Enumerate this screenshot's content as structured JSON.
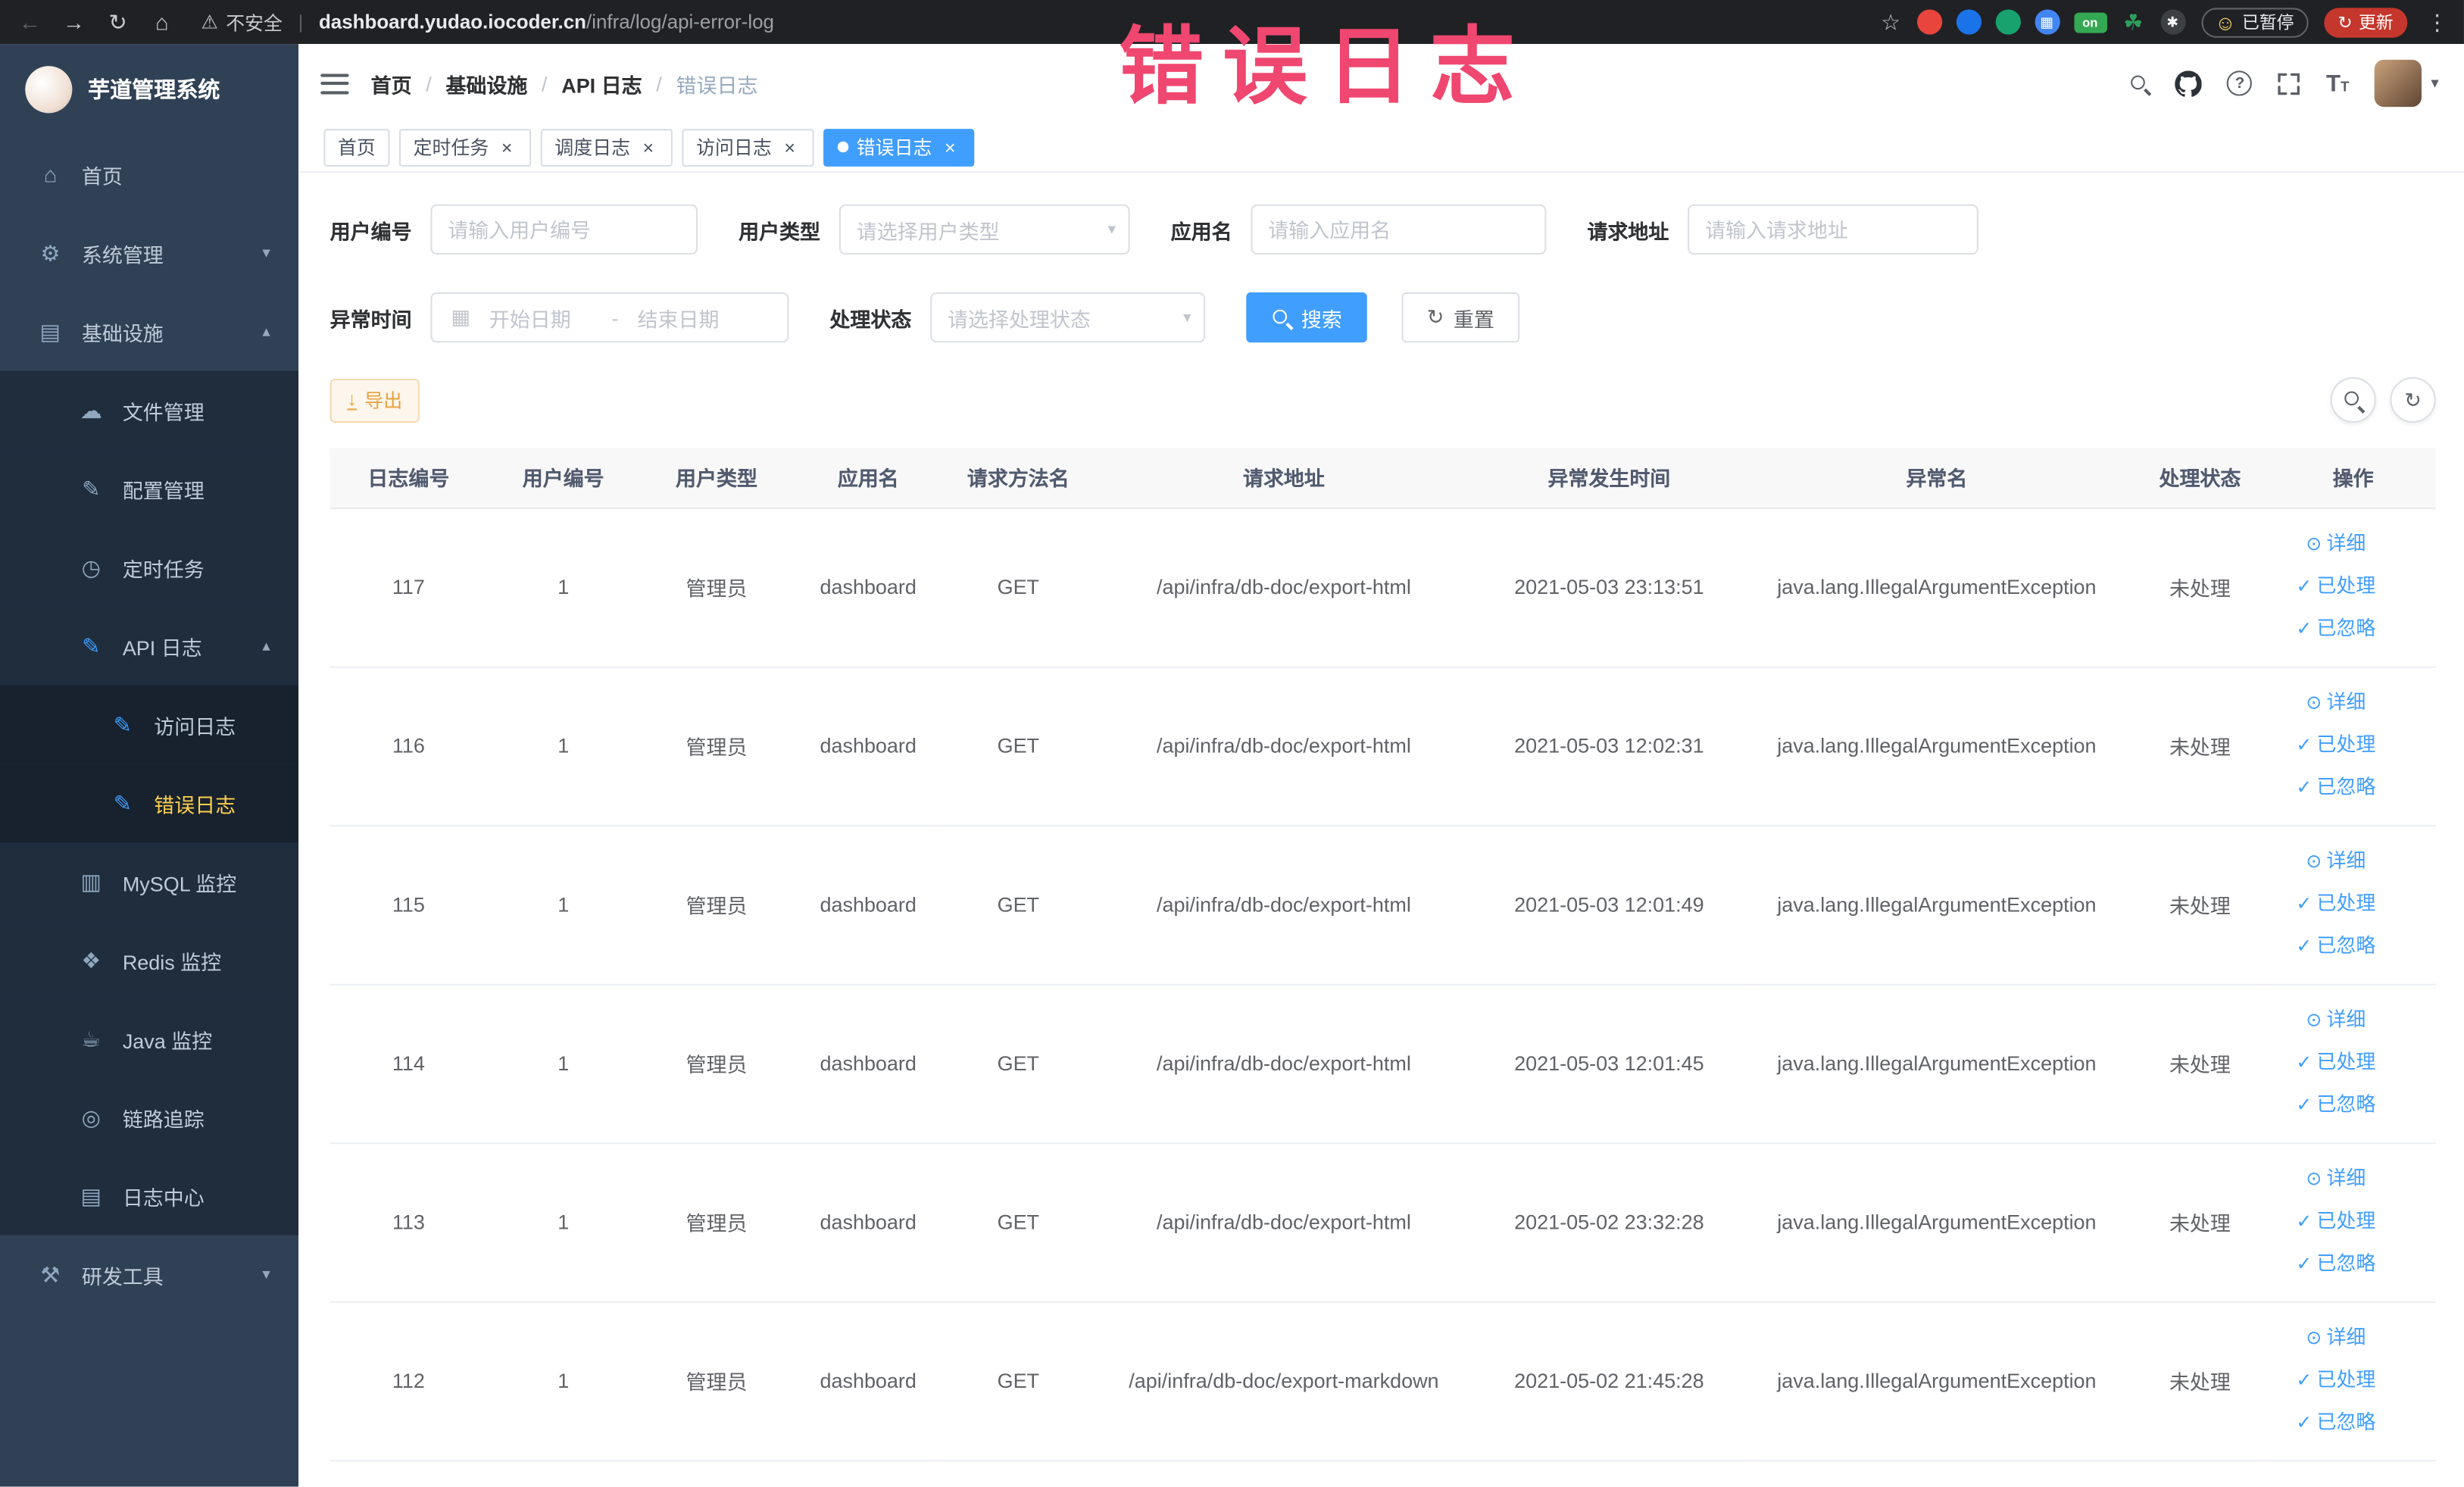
{
  "icons": {
    "warning": "⚠",
    "star": "☆",
    "kebab": "⋮",
    "help": "?",
    "refresh": "↻",
    "download": "↓",
    "calendar": "▦",
    "caret_down": "▾",
    "range_sep": "-",
    "smiley": "☺",
    "divider": "|",
    "font_big": "T",
    "font_small": "T"
  },
  "browser": {
    "nav_icons": [
      {
        "key": "back",
        "glyph": "←",
        "disabled": true
      },
      {
        "key": "forward",
        "glyph": "→"
      },
      {
        "key": "reload",
        "glyph": "↻"
      },
      {
        "key": "home",
        "glyph": "⌂"
      }
    ],
    "security_warning": "不安全",
    "url_domain": "dashboard.yudao.iocoder.cn",
    "url_path": "/infra/log/api-error-log",
    "extensions": [
      {
        "key": "ext-red",
        "color": "#e8453c"
      },
      {
        "key": "ext-blue",
        "color": "#1a73e8"
      },
      {
        "key": "ext-teal",
        "color": "#17a26e"
      },
      {
        "key": "ext-grid",
        "color": "#4285f4",
        "glyph": "▦"
      },
      {
        "key": "ext-on",
        "color": "#34a853",
        "glyph": "on",
        "shape": "badge"
      },
      {
        "key": "ext-leaf",
        "color": "#2e9e5b",
        "glyph": "☘",
        "shape": "plain"
      },
      {
        "key": "ext-dark",
        "color": "#3c4043",
        "glyph": "✱"
      }
    ],
    "paused_label": "已暂停",
    "update_label": "更新"
  },
  "watermark": "错误日志",
  "sidebar": {
    "logo_title": "芋道管理系统",
    "items": [
      {
        "key": "home",
        "label": "首页",
        "icon": "⌂",
        "icon_name": "home-icon",
        "level": 0
      },
      {
        "key": "system",
        "label": "系统管理",
        "icon": "⚙",
        "icon_name": "gear-icon",
        "level": 0,
        "chevron": "down"
      },
      {
        "key": "infra",
        "label": "基础设施",
        "icon": "▤",
        "icon_name": "infra-icon",
        "level": 0,
        "chevron": "up"
      },
      {
        "key": "file",
        "label": "文件管理",
        "icon": "☁",
        "icon_name": "file-icon",
        "level": 1
      },
      {
        "key": "config",
        "label": "配置管理",
        "icon": "✎",
        "icon_name": "config-icon",
        "level": 1
      },
      {
        "key": "job",
        "label": "定时任务",
        "icon": "◷",
        "icon_name": "timer-icon",
        "level": 1
      },
      {
        "key": "api-log",
        "label": "API 日志",
        "icon": "✎",
        "icon_name": "api-log-icon",
        "level": 1,
        "chevron": "up",
        "icon_blue": true
      },
      {
        "key": "access-log",
        "label": "访问日志",
        "icon": "✎",
        "icon_name": "access-log-icon",
        "level": 2,
        "icon_blue": true
      },
      {
        "key": "error-log",
        "label": "错误日志",
        "icon": "✎",
        "icon_name": "error-log-icon",
        "level": 2,
        "icon_blue": true,
        "active": true
      },
      {
        "key": "mysql",
        "label": "MySQL 监控",
        "icon": "▥",
        "icon_name": "mysql-icon",
        "level": 1
      },
      {
        "key": "redis",
        "label": "Redis 监控",
        "icon": "❖",
        "icon_name": "redis-icon",
        "level": 1
      },
      {
        "key": "java",
        "label": "Java 监控",
        "icon": "☕",
        "icon_name": "java-icon",
        "level": 1
      },
      {
        "key": "trace",
        "label": "链路追踪",
        "icon": "◎",
        "icon_name": "trace-icon",
        "level": 1
      },
      {
        "key": "log-center",
        "label": "日志中心",
        "icon": "▤",
        "icon_name": "log-center-icon",
        "level": 1
      },
      {
        "key": "dev-tools",
        "label": "研发工具",
        "icon": "⚒",
        "icon_name": "dev-tools-icon",
        "level": 0,
        "chevron": "down"
      }
    ]
  },
  "breadcrumb": [
    "首页",
    "基础设施",
    "API 日志",
    "错误日志"
  ],
  "tabs": [
    {
      "key": "home",
      "label": "首页",
      "closable": false,
      "active": false
    },
    {
      "key": "cron-job",
      "label": "定时任务",
      "closable": true,
      "active": false
    },
    {
      "key": "job-log",
      "label": "调度日志",
      "closable": true,
      "active": false
    },
    {
      "key": "access-log",
      "label": "访问日志",
      "closable": true,
      "active": false
    },
    {
      "key": "error-log",
      "label": "错误日志",
      "closable": true,
      "active": true
    }
  ],
  "filters": {
    "user_id_label": "用户编号",
    "user_id_placeholder": "请输入用户编号",
    "user_type_label": "用户类型",
    "user_type_placeholder": "请选择用户类型",
    "app_name_label": "应用名",
    "app_name_placeholder": "请输入应用名",
    "request_url_label": "请求地址",
    "request_url_placeholder": "请输入请求地址",
    "exception_time_label": "异常时间",
    "start_date_placeholder": "开始日期",
    "end_date_placeholder": "结束日期",
    "process_status_label": "处理状态",
    "process_status_placeholder": "请选择处理状态",
    "search_label": "搜索",
    "reset_label": "重置"
  },
  "toolbar": {
    "export_label": "导出"
  },
  "table": {
    "headers": [
      {
        "key": "id",
        "label": "日志编号"
      },
      {
        "key": "user_id",
        "label": "用户编号"
      },
      {
        "key": "user_type",
        "label": "用户类型"
      },
      {
        "key": "app_name",
        "label": "应用名"
      },
      {
        "key": "method",
        "label": "请求方法名"
      },
      {
        "key": "url",
        "label": "请求地址"
      },
      {
        "key": "time",
        "label": "异常发生时间"
      },
      {
        "key": "exception",
        "label": "异常名"
      },
      {
        "key": "status",
        "label": "处理状态"
      },
      {
        "key": "actions",
        "label": "操作"
      }
    ],
    "row_actions": [
      {
        "key": "detail",
        "icon": "⊙",
        "label": "详细"
      },
      {
        "key": "processed",
        "icon": "✓",
        "label": "已处理"
      },
      {
        "key": "ignored",
        "icon": "✓",
        "label": "已忽略"
      }
    ],
    "rows": [
      {
        "id": "117",
        "user_id": "1",
        "user_type": "管理员",
        "app_name": "dashboard",
        "method": "GET",
        "url": "/api/infra/db-doc/export-html",
        "time": "2021-05-03 23:13:51",
        "exception": "java.lang.IllegalArgumentException",
        "status": "未处理"
      },
      {
        "id": "116",
        "user_id": "1",
        "user_type": "管理员",
        "app_name": "dashboard",
        "method": "GET",
        "url": "/api/infra/db-doc/export-html",
        "time": "2021-05-03 12:02:31",
        "exception": "java.lang.IllegalArgumentException",
        "status": "未处理"
      },
      {
        "id": "115",
        "user_id": "1",
        "user_type": "管理员",
        "app_name": "dashboard",
        "method": "GET",
        "url": "/api/infra/db-doc/export-html",
        "time": "2021-05-03 12:01:49",
        "exception": "java.lang.IllegalArgumentException",
        "status": "未处理"
      },
      {
        "id": "114",
        "user_id": "1",
        "user_type": "管理员",
        "app_name": "dashboard",
        "method": "GET",
        "url": "/api/infra/db-doc/export-html",
        "time": "2021-05-03 12:01:45",
        "exception": "java.lang.IllegalArgumentException",
        "status": "未处理"
      },
      {
        "id": "113",
        "user_id": "1",
        "user_type": "管理员",
        "app_name": "dashboard",
        "method": "GET",
        "url": "/api/infra/db-doc/export-html",
        "time": "2021-05-02 23:32:28",
        "exception": "java.lang.IllegalArgumentException",
        "status": "未处理"
      },
      {
        "id": "112",
        "user_id": "1",
        "user_type": "管理员",
        "app_name": "dashboard",
        "method": "GET",
        "url": "/api/infra/db-doc/export-markdown",
        "time": "2021-05-02 21:45:28",
        "exception": "java.lang.IllegalArgumentException",
        "status": "未处理"
      }
    ]
  }
}
